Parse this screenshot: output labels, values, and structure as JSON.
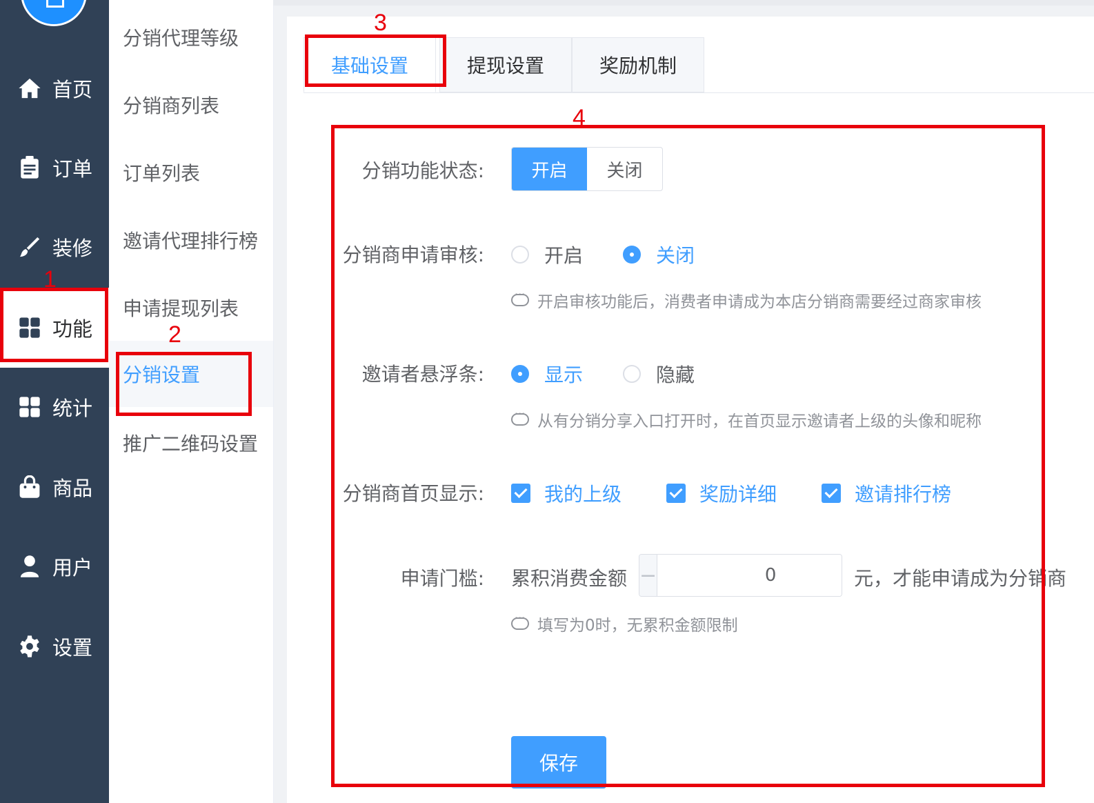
{
  "sidebar": {
    "items": [
      {
        "label": "首页",
        "icon": "home-icon"
      },
      {
        "label": "订单",
        "icon": "clipboard-icon"
      },
      {
        "label": "装修",
        "icon": "brush-icon"
      },
      {
        "label": "功能",
        "icon": "grid-icon"
      },
      {
        "label": "统计",
        "icon": "grid-icon"
      },
      {
        "label": "商品",
        "icon": "shopping-bag-icon"
      },
      {
        "label": "用户",
        "icon": "user-icon"
      },
      {
        "label": "设置",
        "icon": "gear-icon"
      }
    ],
    "active_index": 3
  },
  "subnav": {
    "items": [
      "分销代理等级",
      "分销商列表",
      "订单列表",
      "邀请代理排行榜",
      "申请提现列表",
      "分销设置",
      "推广二维码设置"
    ],
    "active_index": 5
  },
  "tabs": [
    {
      "label": "基础设置",
      "active": true
    },
    {
      "label": "提现设置",
      "active": false
    },
    {
      "label": "奖励机制",
      "active": false
    }
  ],
  "form": {
    "status": {
      "label": "分销功能状态:",
      "on": "开启",
      "off": "关闭",
      "selected": "开启"
    },
    "review": {
      "label": "分销商申请审核:",
      "opt1": "开启",
      "opt2": "关闭",
      "selected": "关闭",
      "hint": "开启审核功能后，消费者申请成为本店分销商需要经过商家审核"
    },
    "float_bar": {
      "label": "邀请者悬浮条:",
      "opt1": "显示",
      "opt2": "隐藏",
      "selected": "显示",
      "hint": "从有分销分享入口打开时，在首页显示邀请者上级的头像和昵称"
    },
    "homepage": {
      "label": "分销商首页显示:",
      "options": [
        "我的上级",
        "奖励详细",
        "邀请排行榜"
      ]
    },
    "threshold": {
      "label": "申请门槛:",
      "prefix": "累积消费金额",
      "value": "0",
      "minus": "−",
      "plus": "+",
      "suffix": "元，才能申请成为分销商",
      "hint": "填写为0时，无累积金额限制"
    },
    "save_label": "保存"
  },
  "annotations": [
    "1",
    "2",
    "3",
    "4"
  ],
  "colors": {
    "primary": "#409eff",
    "sidebar": "#304156",
    "annotation": "#e8000b"
  }
}
